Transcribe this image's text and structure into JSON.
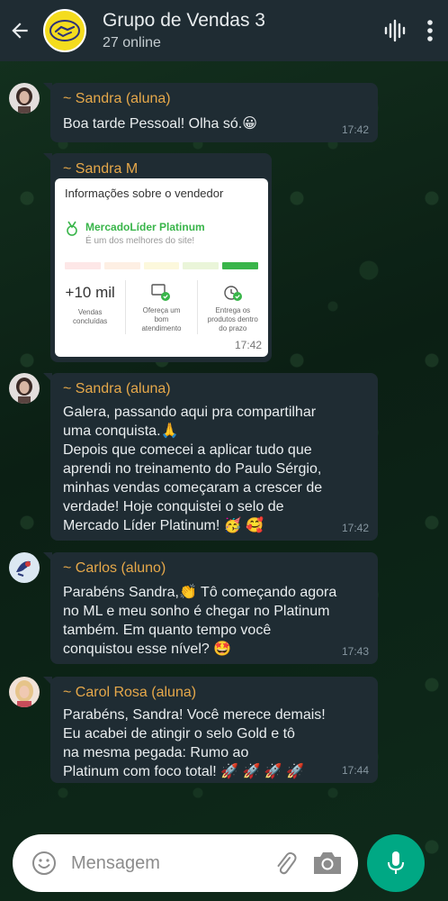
{
  "header": {
    "title": "Grupo de Vendas 3",
    "subtitle": "27 online"
  },
  "messages": [
    {
      "sender": "~ Sandra (aluna)",
      "text": "Boa tarde Pessoal! Olha só.😀",
      "time": "17:42"
    },
    {
      "sender": "~ Sandra M",
      "card": {
        "title": "Informações sobre o vendedor",
        "badge_title": "MercadoLíder Platinum",
        "badge_sub": "É um dos melhores do site!",
        "stat1_value": "+10 mil",
        "stat1_label": "Vendas\nconcluídas",
        "stat2_label": "Ofereça um\nbom\natendimento",
        "stat3_label": "Entrega os\nprodutos dentro\ndo prazo",
        "thermometer_colors": [
          "#fde7e7",
          "#fdefe3",
          "#fcf8dc",
          "#eaf5d9",
          "#39b54a"
        ],
        "time": "17:42"
      }
    },
    {
      "sender": "~ Sandra (aluna)",
      "text": "Galera, passando aqui pra compartilhar\numa conquista.🙏\nDepois que comecei a aplicar tudo que\naprendi no treinamento do Paulo Sérgio,\nminhas vendas começaram a crescer de\nverdade! Hoje conquistei o selo de\nMercado Líder Platinum! 🥳 🥰",
      "time": "17:42"
    },
    {
      "sender": "~ Carlos (aluno)",
      "text": "Parabéns Sandra,👏 Tô começando agora\nno ML e meu sonho é chegar no Platinum\ntambém. Em quanto tempo você\nconquistou esse nível? 🤩",
      "time": "17:43"
    },
    {
      "sender": "~ Carol Rosa (aluna)",
      "text": "Parabéns, Sandra!  Você merece demais!\nEu acabei de atingir o selo Gold e tô\nna mesma pegada: Rumo ao\nPlatinum com foco total! 🚀 🚀 🚀 🚀",
      "time": "17:44"
    }
  ],
  "input": {
    "placeholder": "Mensagem"
  },
  "icons": {
    "back": "arrow-left-icon",
    "voice_call": "audio-wave-icon",
    "menu": "more-vertical-icon",
    "emoji": "emoji-icon",
    "attach": "paperclip-icon",
    "camera": "camera-icon",
    "mic": "microphone-icon"
  },
  "colors": {
    "header_bg": "#1f2c33",
    "bubble_bg": "#1f2c33",
    "sender_name": "#e6a84a",
    "accent_green": "#00a884"
  }
}
